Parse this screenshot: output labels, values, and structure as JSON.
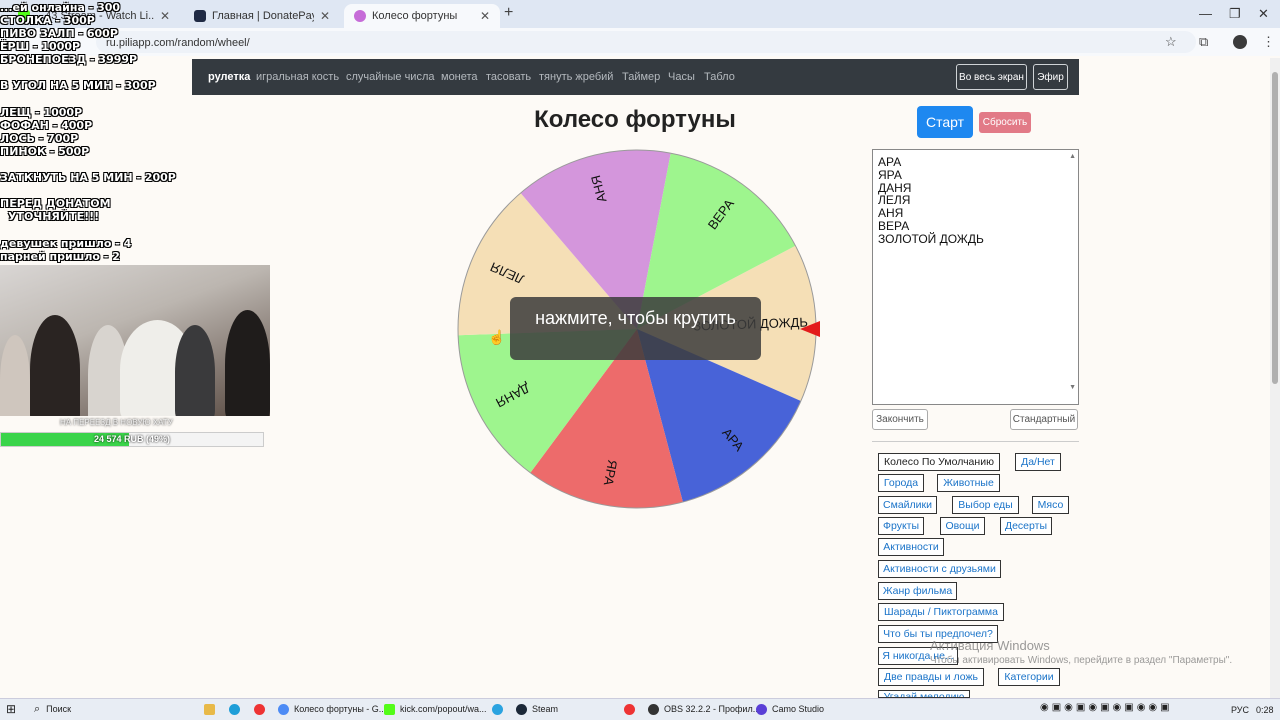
{
  "browser": {
    "tabs": [
      {
        "label": "...43 Stream - Watch Li...",
        "color": "#53fc18"
      },
      {
        "label": "Главная | DonatePay",
        "color": "#1f2a44"
      },
      {
        "label": "Колесо фортуны",
        "color": "#c66cd8"
      }
    ],
    "url": "ru.piliapp.com/random/wheel/"
  },
  "overlay": {
    "lines": [
      "...ей онлайна - 300",
      "СТОЛКА - 300Р",
      "ПИВО ЗАЛП - 600Р",
      "ЁРШ - 1000Р",
      "БРОНЕПОЕЗД - 3999Р",
      "В УГОЛ НА 5 МИН - 300Р",
      "ЛЕЩ - 1000Р",
      "ФОФАН - 400Р",
      "ЛОСЬ - 700Р",
      "ПИНОК - 500Р",
      "ЗАТКНУТЬ НА 5 МИН - 200Р",
      "ПЕРЕД ДОНАТОМ",
      "УТОЧНЯЙТЕ!!!",
      "девушек пришло - 4",
      "парней пришло - 2"
    ],
    "caption": "НА ПЕРЕЕЗД В НОВУЮ ХАТУ",
    "progress_text": "24 574 RUB (49%)",
    "progress_fraction": 0.49
  },
  "nav": {
    "links": [
      "рулетка",
      "игральная кость",
      "случайные числа",
      "монета",
      "тасовать",
      "тянуть жребий",
      "Таймер",
      "Часы",
      "Табло"
    ],
    "fullscreen": "Во весь экран",
    "broadcast": "Эфир"
  },
  "title": "Колесо фортуны",
  "start_label": "Старт",
  "reset_label": "Сбросить",
  "wheel": {
    "hint": "нажмите, чтобы крутить",
    "segments": [
      {
        "label": "ЗОЛОТОЙ ДОЖДЬ",
        "color": "#f5dfb6"
      },
      {
        "label": "АРА",
        "color": "#4863d8"
      },
      {
        "label": "ЯРА",
        "color": "#ed6b6b"
      },
      {
        "label": "ДАНЯ",
        "color": "#9ef58e"
      },
      {
        "label": "ЛЕЛЯ",
        "color": "#f5dfb6"
      },
      {
        "label": "АНЯ",
        "color": "#d496dc"
      },
      {
        "label": "ВЕРА",
        "color": "#9ef58e"
      }
    ]
  },
  "list_items": [
    "АРА",
    "ЯРА",
    "ДАНЯ",
    "ЛЕЛЯ",
    "АНЯ",
    "ВЕРА",
    "ЗОЛОТОЙ ДОЖДЬ"
  ],
  "finish_label": "Закончить",
  "standard_label": "Стандартный",
  "presets": [
    "Колесо По Умолчанию",
    "Да/Нет",
    "Города",
    "Животные",
    "Смайлики",
    "Выбор еды",
    "Мясо",
    "Фрукты",
    "Овощи",
    "Десерты",
    "Активности",
    "Активности с друзьями",
    "Жанр фильма",
    "Шарады / Пиктограмма",
    "Что бы ты предпочел?",
    "Я никогда не...",
    "Две правды и ложь",
    "Категории",
    "Угадай мелодию"
  ],
  "activation": {
    "title": "Активация Windows",
    "text": "Чтобы активировать Windows, перейдите в раздел \"Параметры\"."
  },
  "taskbar": {
    "search": "Поиск",
    "items": [
      "Колесо фортуны - G...",
      "kick.com/popout/wa...",
      "Steam",
      "OBS 32.2.2 - Профил...",
      "Camo Studio"
    ],
    "lang": "РУС",
    "time": "0:28"
  }
}
